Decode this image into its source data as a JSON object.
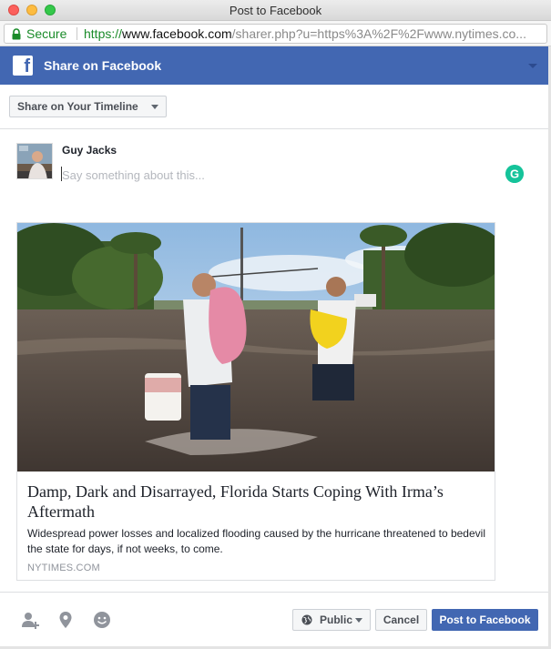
{
  "window": {
    "title": "Post to Facebook"
  },
  "address_bar": {
    "secure_label": "Secure",
    "url_scheme": "https://",
    "url_host": "www.facebook.com",
    "url_path": "/sharer.php?u=https%3A%2F%2Fwww.nytimes.co..."
  },
  "header": {
    "logo_letter": "f",
    "title": "Share on Facebook"
  },
  "share_target": {
    "selected": "Share on Your Timeline"
  },
  "composer": {
    "user_name": "Guy Jacks",
    "placeholder": "Say something about this...",
    "grammarly_letter": "G"
  },
  "preview": {
    "title": "Damp, Dark and Disarrayed, Florida Starts Coping With Irma’s Aftermath",
    "description": "Widespread power losses and localized flooding caused by the hurricane threatened to bedevil the state for days, if not weeks, to come.",
    "source": "NYTIMES.COM"
  },
  "footer": {
    "icons": [
      "tag-friends-icon",
      "location-pin-icon",
      "emoji-icon"
    ],
    "privacy_label": "Public",
    "cancel_label": "Cancel",
    "post_label": "Post to Facebook"
  },
  "colors": {
    "facebook_blue": "#4267b2",
    "secure_green": "#1a8b29",
    "grammarly_green": "#15c39a"
  }
}
